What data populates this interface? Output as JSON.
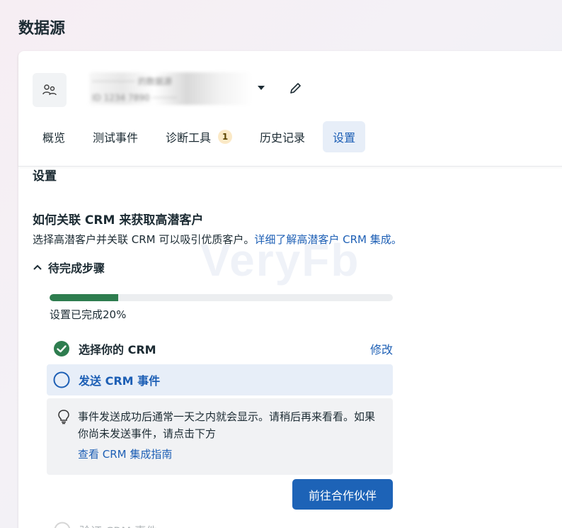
{
  "page": {
    "title": "数据源"
  },
  "datasource": {
    "name_obscured": "················ 的数据源",
    "id_obscured": "ID 1234 7890 ·········"
  },
  "tabs": [
    {
      "label": "概览"
    },
    {
      "label": "测试事件"
    },
    {
      "label": "诊断工具",
      "badge": "1"
    },
    {
      "label": "历史记录"
    },
    {
      "label": "设置",
      "active": true
    }
  ],
  "section": {
    "title": "设置"
  },
  "crm": {
    "heading": "如何关联 CRM 来获取高潜客户",
    "description": "选择高潜客户并关联 CRM 可以吸引优质客户。",
    "learn_more": "详细了解高潜客户 CRM 集成。"
  },
  "steps": {
    "toggle_label": "待完成步骤",
    "progress_percent": 20,
    "progress_text": "设置已完成20%",
    "items": [
      {
        "label": "选择你的 CRM",
        "status": "done",
        "action": "修改"
      },
      {
        "label": "发送 CRM 事件",
        "status": "current"
      },
      {
        "label": "验证 CRM 事件",
        "status": "pending"
      }
    ],
    "info_text": "事件发送成功后通常一天之内就会显示。请稍后再来看看。如果你尚未发送事件，请点击下方",
    "info_link": "查看 CRM 集成指南",
    "partner_button": "前往合作伙伴"
  },
  "watermark": "VeryFb",
  "colors": {
    "accent": "#1d5fb5",
    "progress": "#2e7d4f",
    "done": "#2e7d4f",
    "button": "#1d63b7"
  }
}
